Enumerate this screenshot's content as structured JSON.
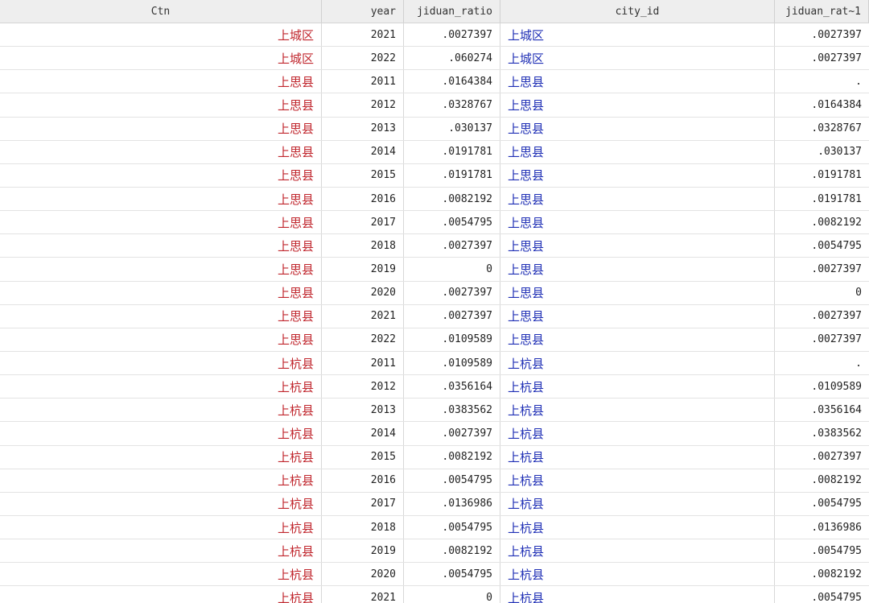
{
  "colors": {
    "string_text": "#c0262d",
    "labeled_text": "#1f2fb5",
    "header_bg": "#eeeeee"
  },
  "columns": [
    "Ctn",
    "year",
    "jiduan_ratio",
    "city_id",
    "jiduan_rat~1"
  ],
  "rows": [
    [
      "上城区",
      "2021",
      ".0027397",
      "上城区",
      ".0027397"
    ],
    [
      "上城区",
      "2022",
      ".060274",
      "上城区",
      ".0027397"
    ],
    [
      "上思县",
      "2011",
      ".0164384",
      "上思县",
      "."
    ],
    [
      "上思县",
      "2012",
      ".0328767",
      "上思县",
      ".0164384"
    ],
    [
      "上思县",
      "2013",
      ".030137",
      "上思县",
      ".0328767"
    ],
    [
      "上思县",
      "2014",
      ".0191781",
      "上思县",
      ".030137"
    ],
    [
      "上思县",
      "2015",
      ".0191781",
      "上思县",
      ".0191781"
    ],
    [
      "上思县",
      "2016",
      ".0082192",
      "上思县",
      ".0191781"
    ],
    [
      "上思县",
      "2017",
      ".0054795",
      "上思县",
      ".0082192"
    ],
    [
      "上思县",
      "2018",
      ".0027397",
      "上思县",
      ".0054795"
    ],
    [
      "上思县",
      "2019",
      "0",
      "上思县",
      ".0027397"
    ],
    [
      "上思县",
      "2020",
      ".0027397",
      "上思县",
      "0"
    ],
    [
      "上思县",
      "2021",
      ".0027397",
      "上思县",
      ".0027397"
    ],
    [
      "上思县",
      "2022",
      ".0109589",
      "上思县",
      ".0027397"
    ],
    [
      "上杭县",
      "2011",
      ".0109589",
      "上杭县",
      "."
    ],
    [
      "上杭县",
      "2012",
      ".0356164",
      "上杭县",
      ".0109589"
    ],
    [
      "上杭县",
      "2013",
      ".0383562",
      "上杭县",
      ".0356164"
    ],
    [
      "上杭县",
      "2014",
      ".0027397",
      "上杭县",
      ".0383562"
    ],
    [
      "上杭县",
      "2015",
      ".0082192",
      "上杭县",
      ".0027397"
    ],
    [
      "上杭县",
      "2016",
      ".0054795",
      "上杭县",
      ".0082192"
    ],
    [
      "上杭县",
      "2017",
      ".0136986",
      "上杭县",
      ".0054795"
    ],
    [
      "上杭县",
      "2018",
      ".0054795",
      "上杭县",
      ".0136986"
    ],
    [
      "上杭县",
      "2019",
      ".0082192",
      "上杭县",
      ".0054795"
    ],
    [
      "上杭县",
      "2020",
      ".0054795",
      "上杭县",
      ".0082192"
    ],
    [
      "上杭县",
      "2021",
      "0",
      "上杭县",
      ".0054795"
    ]
  ]
}
